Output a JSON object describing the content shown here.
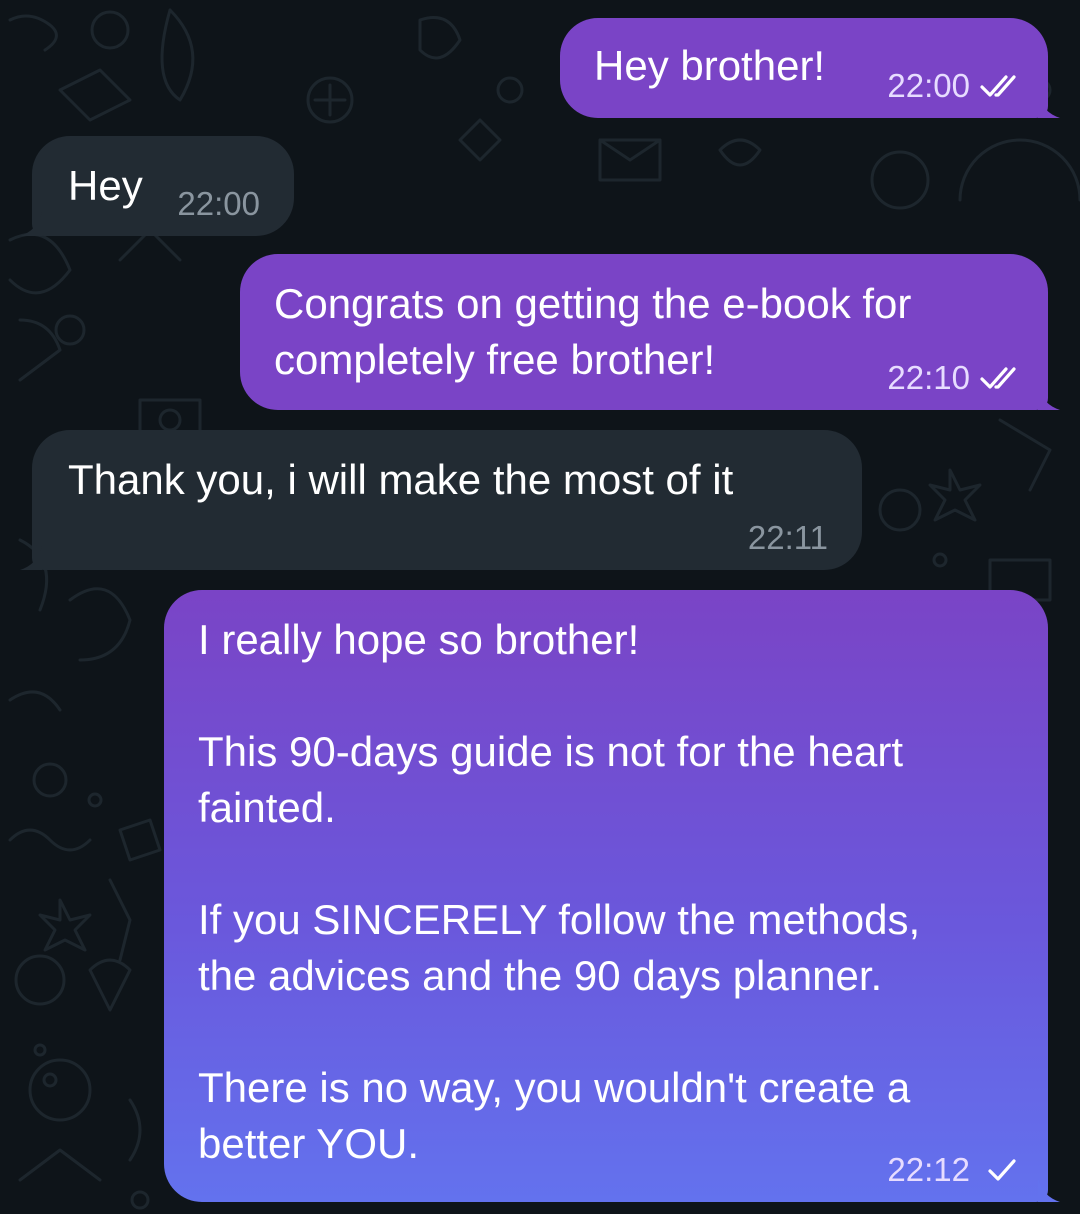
{
  "conversation": {
    "messages": [
      {
        "direction": "outgoing",
        "text": "Hey brother!",
        "time": "22:00",
        "status": "read",
        "status_icon": "double-check-icon"
      },
      {
        "direction": "incoming",
        "text": "Hey",
        "time": "22:00"
      },
      {
        "direction": "outgoing",
        "text": "Congrats on getting the e-book for\ncompletely free brother!",
        "time": "22:10",
        "status": "read",
        "status_icon": "double-check-icon"
      },
      {
        "direction": "incoming",
        "text": "Thank you, i will make the most of it",
        "time": "22:11"
      },
      {
        "direction": "outgoing",
        "text": "I really hope so brother!\n\nThis 90-days guide is not for the heart\nfainted.\n\nIf you SINCERELY follow the methods,\nthe advices and the 90 days planner.\n\nThere is no way, you wouldn't create a\nbetter YOU.",
        "time": "22:12",
        "status": "sent",
        "status_icon": "single-check-icon"
      }
    ]
  },
  "colors": {
    "background": "#0e1419",
    "incoming_bubble": "#222b33",
    "outgoing_bubble": "#7a44c6",
    "outgoing_gradient_top": "#7a44c6",
    "outgoing_gradient_bottom": "#6372ee"
  }
}
